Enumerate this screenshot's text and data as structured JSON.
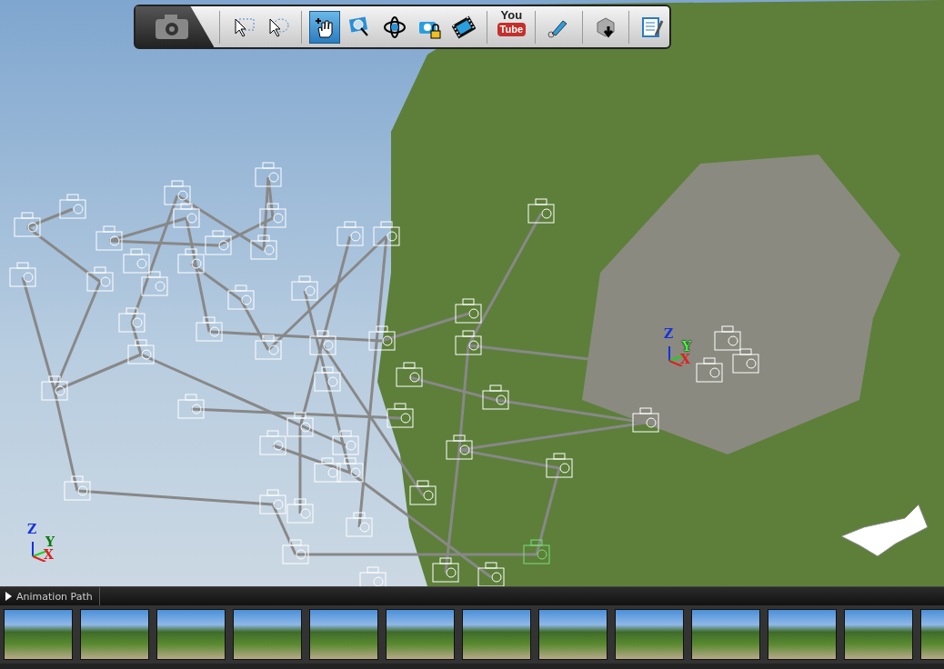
{
  "toolbar": {
    "tools": [
      {
        "kind": "icon",
        "selected": false
      },
      {
        "kind": "icon",
        "selected": false
      },
      {
        "kind": "icon",
        "selected": true
      },
      {
        "kind": "icon",
        "selected": false
      },
      {
        "kind": "icon",
        "selected": false
      },
      {
        "kind": "icon",
        "selected": false
      },
      {
        "kind": "icon",
        "selected": false
      },
      {
        "kind": "logo",
        "selected": false,
        "top": "You",
        "bottom": "Tube"
      },
      {
        "kind": "icon",
        "selected": false
      },
      {
        "kind": "icon",
        "selected": false
      },
      {
        "kind": "icon",
        "selected": false
      }
    ]
  },
  "viewport": {
    "axes": [
      {
        "z": "Z",
        "y": "Y",
        "x": "X"
      },
      {
        "z": "Z",
        "y": "Y",
        "x": "X"
      }
    ]
  },
  "panel": {
    "title": "Animation Path",
    "expanded": false
  }
}
